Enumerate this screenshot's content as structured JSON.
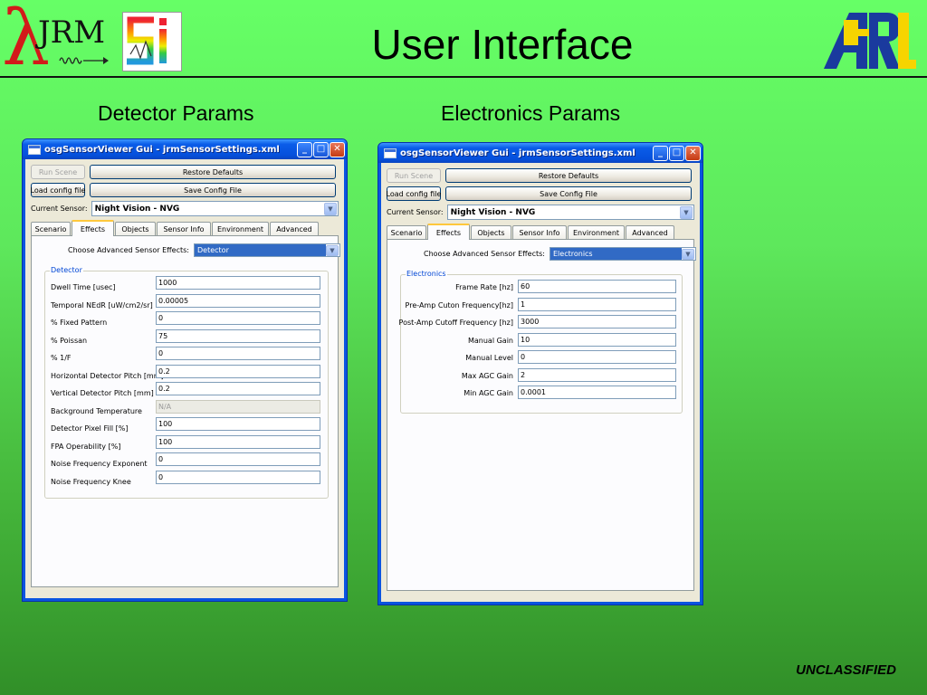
{
  "slide": {
    "title": "User Interface",
    "logos": {
      "left": "JRM",
      "lambda": "λ",
      "right": "ARL"
    },
    "footer": "UNCLASSIFIED"
  },
  "colors": {
    "background": "#5ee85c",
    "window_frame": "#0a54e0",
    "dialog": "#ece9d8",
    "selection": "#316ac5"
  },
  "detector_view": {
    "section_title": "Detector Params",
    "window": {
      "title": "osgSensorViewer Gui - jrmSensorSettings.xml",
      "run_scene": "Run Scene",
      "restore_defaults": "Restore Defaults",
      "load_config": "Load config file",
      "save_config": "Save Config File",
      "current_sensor_label": "Current Sensor:",
      "current_sensor_value": "Night Vision - NVG",
      "tabs": [
        "Scenario",
        "Effects",
        "Objects",
        "Sensor Info",
        "Environment",
        "Advanced"
      ],
      "active_tab": "Effects",
      "effects_label": "Choose Advanced Sensor Effects:",
      "effects_value": "Detector",
      "group_title": "Detector",
      "fields": [
        {
          "label": "Dwell Time [usec]",
          "value": "1000"
        },
        {
          "label": "Temporal NEdR [uW/cm2/sr]",
          "value": "0.00005"
        },
        {
          "label": "% Fixed Pattern",
          "value": "0"
        },
        {
          "label": "% Poissan",
          "value": "75"
        },
        {
          "label": "% 1/F",
          "value": "0"
        },
        {
          "label": "Horizontal Detector Pitch [mm]",
          "value": "0.2"
        },
        {
          "label": "Vertical Detector Pitch [mm]",
          "value": "0.2"
        },
        {
          "label": "Background Temperature",
          "value": "N/A",
          "disabled": true
        },
        {
          "label": "Detector Pixel Fill [%]",
          "value": "100"
        },
        {
          "label": "FPA Operability [%]",
          "value": "100"
        },
        {
          "label": "Noise Frequency Exponent",
          "value": "0"
        },
        {
          "label": "Noise Frequency Knee",
          "value": "0"
        }
      ]
    }
  },
  "electronics_view": {
    "section_title": "Electronics Params",
    "window": {
      "title": "osgSensorViewer Gui - jrmSensorSettings.xml",
      "run_scene": "Run Scene",
      "restore_defaults": "Restore Defaults",
      "load_config": "Load config file",
      "save_config": "Save Config File",
      "current_sensor_label": "Current Sensor:",
      "current_sensor_value": "Night Vision - NVG",
      "tabs": [
        "Scenario",
        "Effects",
        "Objects",
        "Sensor Info",
        "Environment",
        "Advanced"
      ],
      "active_tab": "Effects",
      "effects_label": "Choose Advanced Sensor Effects:",
      "effects_value": "Electronics",
      "group_title": "Electronics",
      "fields": [
        {
          "label": "Frame Rate [hz]",
          "value": "60"
        },
        {
          "label": "Pre-Amp Cuton Frequency[hz]",
          "value": "1"
        },
        {
          "label": "Post-Amp Cutoff Frequency [hz]",
          "value": "3000"
        },
        {
          "label": "Manual Gain",
          "value": "10"
        },
        {
          "label": "Manual Level",
          "value": "0"
        },
        {
          "label": "Max AGC Gain",
          "value": "2"
        },
        {
          "label": "Min AGC Gain",
          "value": "0.0001"
        }
      ]
    }
  }
}
